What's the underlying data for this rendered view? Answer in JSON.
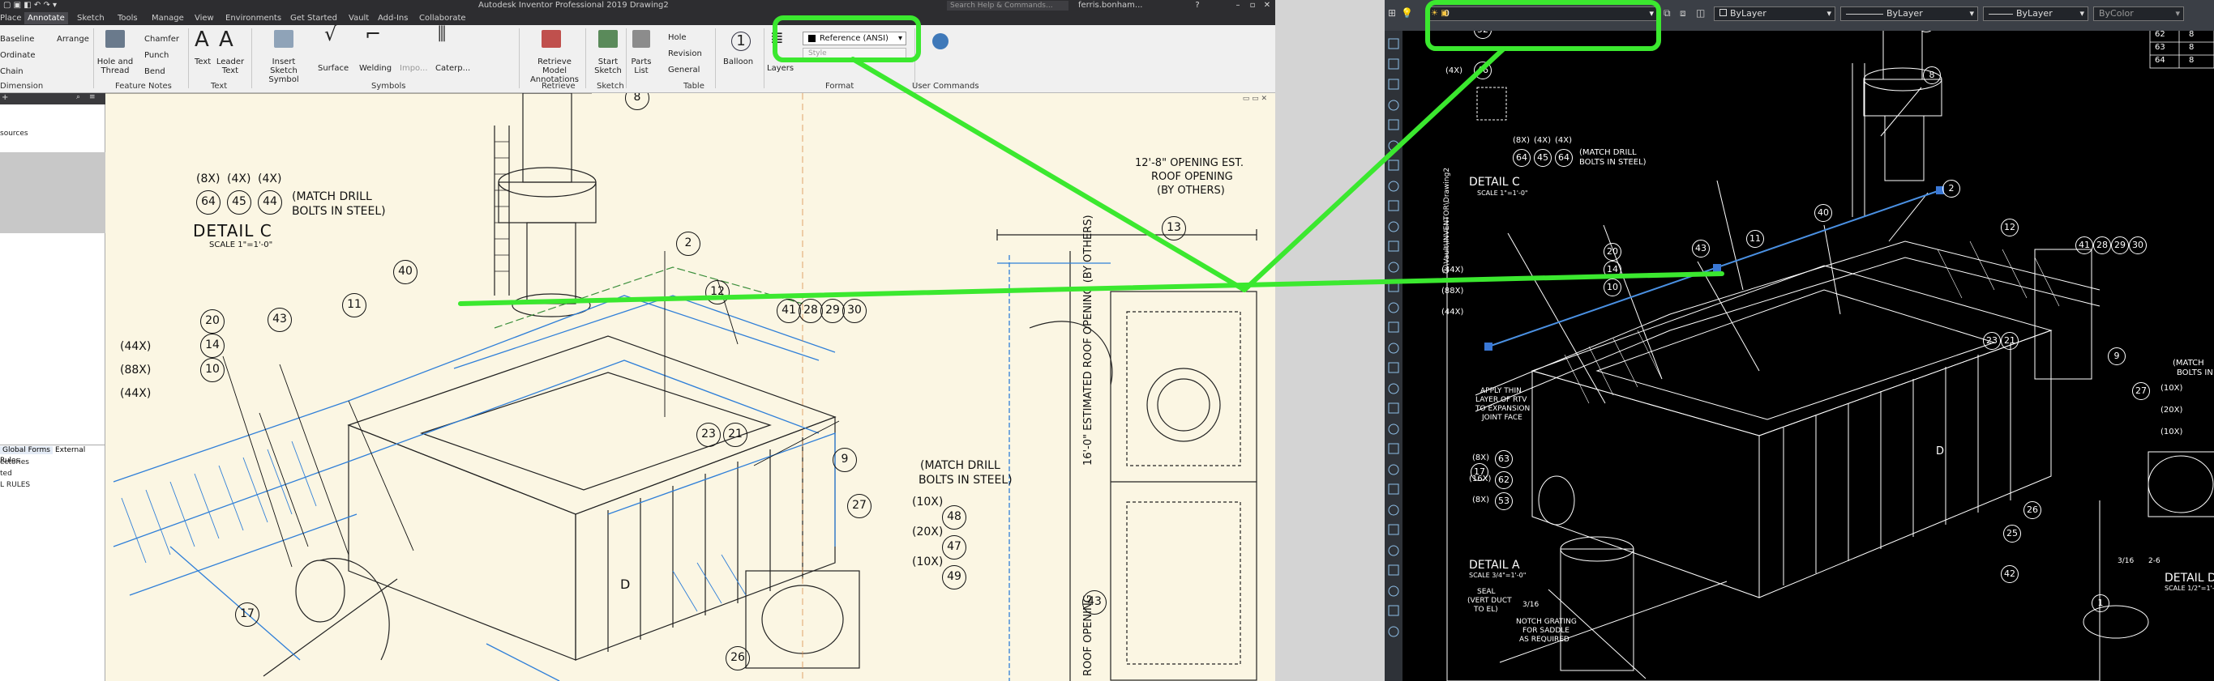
{
  "inventor": {
    "title": "Autodesk Inventor Professional 2019   Drawing2",
    "search_placeholder": "Search Help & Commands...",
    "user": "ferris.bonham...",
    "tabs": [
      "Place Views",
      "Annotate",
      "Sketch",
      "Tools",
      "Manage",
      "View",
      "Environments",
      "Get Started",
      "Vault",
      "Add-Ins",
      "Collaborate"
    ],
    "active_tab": "Annotate",
    "ribbon": {
      "dimension_items": [
        "Baseline",
        "Ordinate",
        "Chain"
      ],
      "dimension_group": "Dimension",
      "arrange": "Arrange",
      "feature_notes_items": [
        "Hole and Thread",
        "Chamfer",
        "Punch",
        "Bend"
      ],
      "feature_notes_group": "Feature Notes",
      "text_items": [
        "Text",
        "Leader Text"
      ],
      "text_group": "Text",
      "symbols_items": [
        "Insert Sketch Symbol",
        "Surface",
        "Welding",
        "Impo...",
        "Caterp..."
      ],
      "symbols_group": "Symbols",
      "retrieve_items": [
        "Retrieve Model Annotations"
      ],
      "retrieve_group": "Retrieve",
      "sketch_items": [
        "Start Sketch"
      ],
      "sketch_group": "Sketch",
      "table_items": [
        "Parts List",
        "Hole",
        "Revision",
        "General"
      ],
      "table_group": "Table",
      "balloon": "Balloon",
      "layers": "Layers",
      "format_style": "Reference (ANSI)",
      "format_style2": "Style",
      "format_group": "Format",
      "user_commands_group": "User Commands"
    },
    "browser": {
      "sources": "sources",
      "tabs": [
        "Global Forms",
        "External Rules"
      ],
      "rules": [
        "ectories",
        "ted",
        "L RULES"
      ]
    },
    "drawing": {
      "detail_c": "DETAIL  C",
      "detail_c_scale": "SCALE 1\"=1'-0\"",
      "qty_labels": [
        "(8X)",
        "(4X)",
        "(4X)"
      ],
      "qty_bubbles": [
        "64",
        "45",
        "44"
      ],
      "match_drill": [
        "(MATCH DRILL",
        "BOLTS IN STEEL)"
      ],
      "opening_top": [
        "12'-8\" OPENING EST.",
        "ROOF OPENING",
        "(BY OTHERS)"
      ],
      "opening_side": "16'-0\" ESTIMATED ROOF OPENING (BY OTHERS)",
      "opening_side2": "ROOF OPENING",
      "qty_left": [
        "(44X)",
        "(88X)",
        "(44X)"
      ],
      "qty_right": [
        "(10X)",
        "(20X)",
        "(10X)"
      ],
      "bubbles": [
        "8",
        "2",
        "12",
        "40",
        "11",
        "43",
        "20",
        "14",
        "10",
        "41",
        "28",
        "29",
        "30",
        "13",
        "23",
        "21",
        "9",
        "27",
        "48",
        "47",
        "49",
        "17",
        "26",
        "43"
      ],
      "section_d": "D"
    }
  },
  "autocad": {
    "layer_value": "0",
    "color_value": "ByLayer",
    "linetype_value": "ByLayer",
    "lineweight_value": "ByLayer",
    "plotstyle_value": "ByColor",
    "table_values": [
      "62",
      "63",
      "64"
    ],
    "table_values2": [
      "8",
      "8",
      "8"
    ],
    "path_text": "C:\\Vault\\INVENTOR\\Drawing2",
    "detail_c": "DETAIL  C",
    "detail_c_scale": "SCALE 1\"=1'-0\"",
    "qty_labels": [
      "(8X)",
      "(4X)",
      "(4X)"
    ],
    "qty_bubbles": [
      "64",
      "45",
      "64"
    ],
    "match_drill": [
      "(MATCH DRILL",
      "BOLTS IN STEEL)"
    ],
    "qty_left": [
      "(44X)",
      "(88X)",
      "(44X)"
    ],
    "apply_note": [
      "APPLY THIN",
      "LAYER OF RTV",
      "TO EXPANSION",
      "JOINT FACE"
    ],
    "qty_a": [
      "(8X)",
      "(16X)",
      "(8X)"
    ],
    "bubbles_a": [
      "63",
      "62",
      "53"
    ],
    "detail_a": "DETAIL  A",
    "detail_a_scale": "SCALE 3/4\"=1'-0\"",
    "seal_note": [
      "SEAL",
      "(VERT DUCT",
      "TO EL)"
    ],
    "notch_note": [
      "NOTCH GRATING",
      "FOR SADDLE",
      "AS REQUIRED"
    ],
    "weld": "3/16",
    "detail_d": "DETAIL  D",
    "detail_d_scale": "SCALE 1/2\"=1'-0\"",
    "weld2": "3/16",
    "weld2b": "2-6",
    "match_drill_r": [
      "(MATCH",
      "BOLTS IN"
    ],
    "qty_right": [
      "(10X)",
      "(20X)",
      "(10X)"
    ],
    "top_bubbles": [
      "52",
      "46"
    ],
    "top_qty": "(4X)",
    "bubbles": [
      "1",
      "8",
      "2",
      "40",
      "12",
      "11",
      "43",
      "20",
      "14",
      "10",
      "41",
      "28",
      "29",
      "30",
      "23",
      "21",
      "9",
      "27",
      "17",
      "26",
      "25",
      "42",
      "1"
    ],
    "section_d": "D"
  },
  "colors": {
    "highlight": "#3be82f",
    "paper": "#fbf6e3",
    "inventor_blue": "#2f7fd8",
    "acad_bg": "#000000",
    "acad_blue_line": "#4a90e2"
  }
}
